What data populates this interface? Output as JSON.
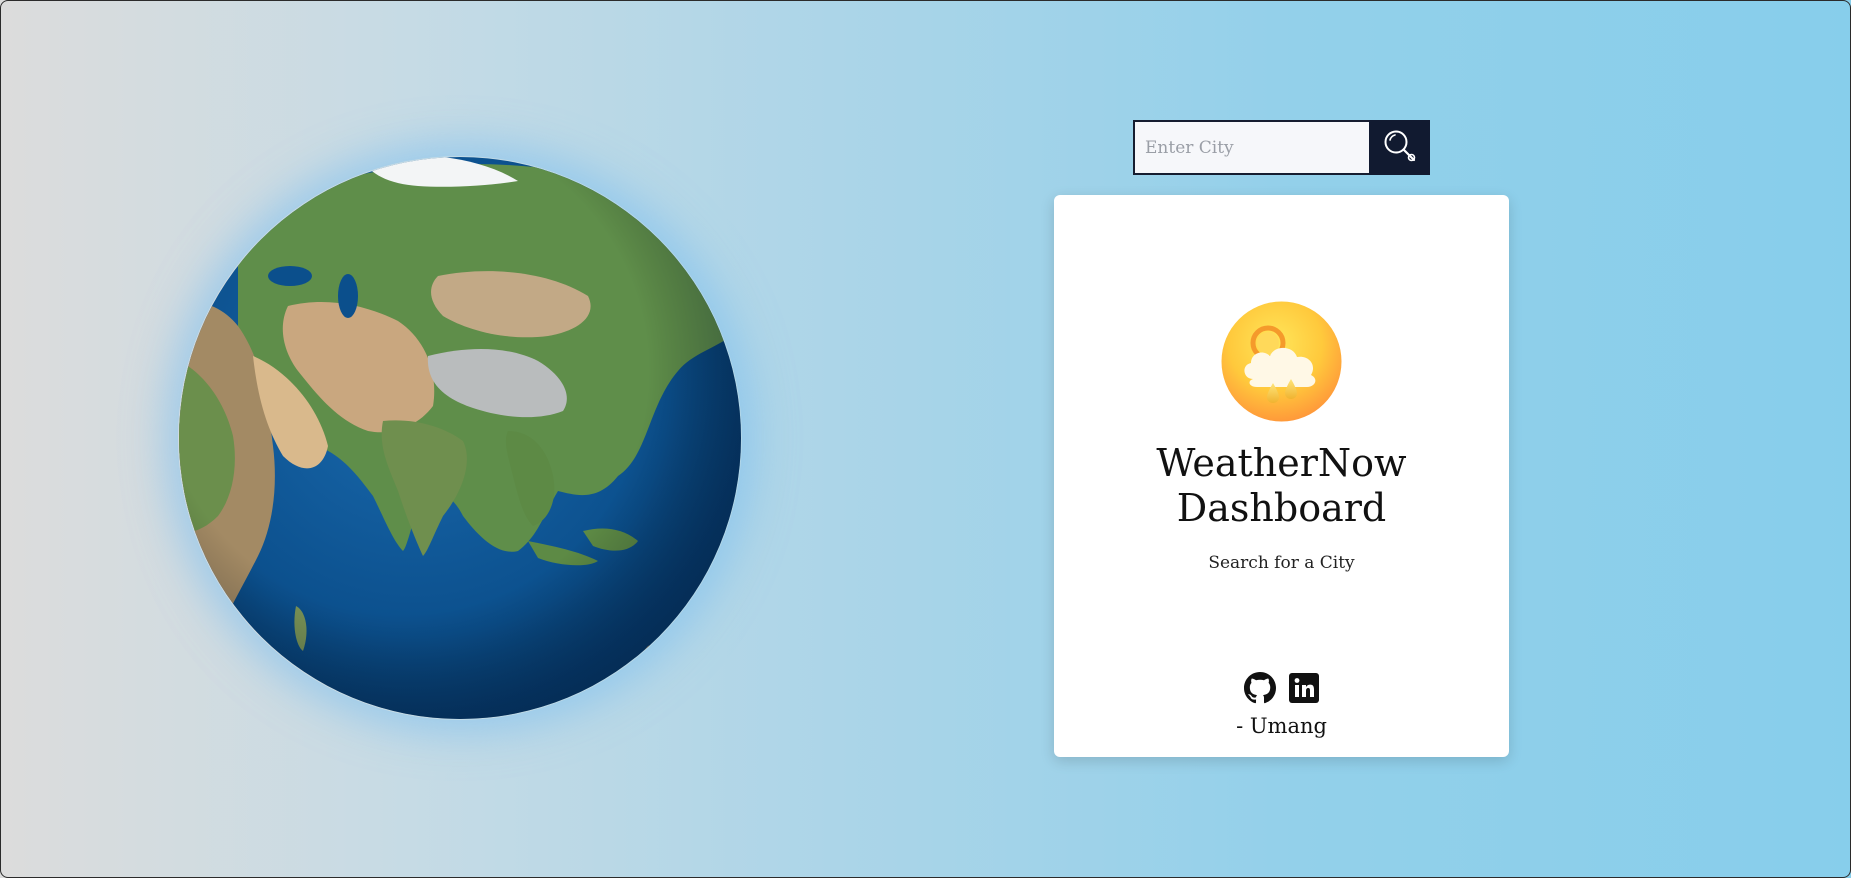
{
  "search": {
    "placeholder": "Enter City",
    "value": "",
    "button_icon": "search-icon"
  },
  "card": {
    "weather_icon": "sun-cloud-rain-icon",
    "title": "WeatherNow Dashboard",
    "subtitle": "Search for a City",
    "social_icons": [
      "github-icon",
      "linkedin-icon"
    ],
    "author": "- Umang"
  },
  "globe": {
    "icon": "earth-globe-icon"
  },
  "colors": {
    "search_button": "#111a30",
    "background_start": "#dcdcdc",
    "background_end": "#87ceeb",
    "ocean": "#0a4f8f"
  }
}
